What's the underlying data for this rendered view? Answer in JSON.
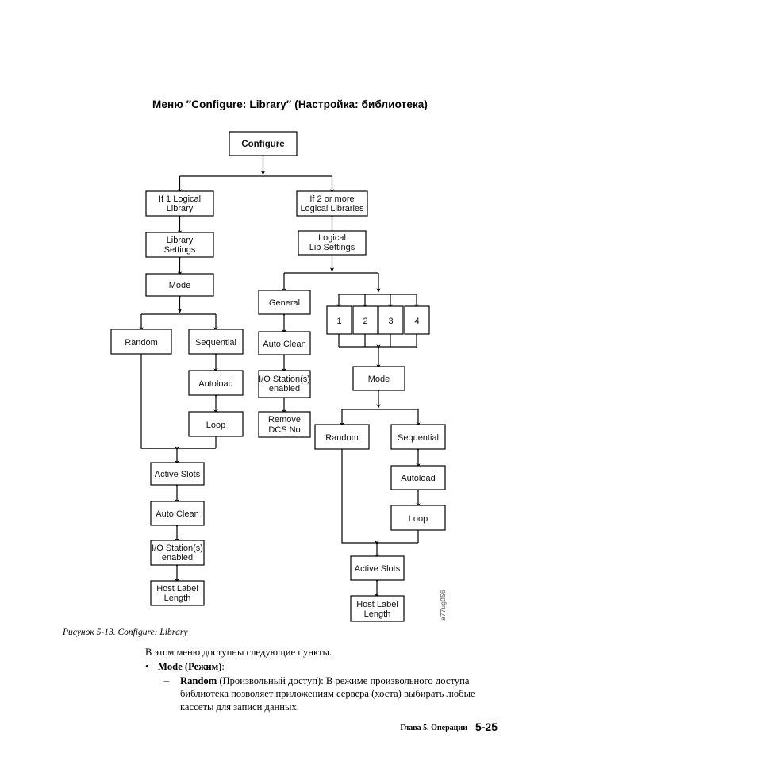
{
  "page": {
    "title": "Меню ″Configure: Library″ (Настройка: библиотека)",
    "figure_caption": "Рисунок 5-13. Configure: Library",
    "figure_id": "a77ug056",
    "intro_paragraph": "В этом меню доступны следующие пункты.",
    "footer_chapter": "Глава 5. Операции",
    "footer_page": "5-25"
  },
  "bullets": {
    "level1_marker": "•",
    "level1_bold": "Mode (Режим)",
    "level1_tail": ":",
    "level2_marker": "–",
    "level2_bold": "Random",
    "level2_text": " (Произвольный доступ): В режиме произвольного доступа библиотека позволяет приложениям сервера (хоста) выбирать любые кассеты для записи данных."
  },
  "diagram": {
    "type": "flowchart",
    "nodes": {
      "configure": "Configure",
      "if_1_logical_library": "If 1 Logical\nLibrary",
      "if_1_logical_library_l1": "If 1 Logical",
      "if_1_logical_library_l2": "Library",
      "if_2_or_more": "If 2 or more\nLogical Libraries",
      "if_2_or_more_l1": "If 2 or more",
      "if_2_or_more_l2": "Logical Libraries",
      "library_settings_l1": "Library",
      "library_settings_l2": "Settings",
      "logical_lib_settings_l1": "Logical",
      "logical_lib_settings_l2": "Lib Settings",
      "mode_left": "Mode",
      "mode_right": "Mode",
      "random_left": "Random",
      "sequential_left": "Sequential",
      "autoload_left": "Autoload",
      "loop_left": "Loop",
      "active_slots_left": "Active Slots",
      "auto_clean_left": "Auto Clean",
      "io_station_left_l1": "I/O Station(s)",
      "io_station_left_l2": "enabled",
      "host_label_left_l1": "Host Label",
      "host_label_left_l2": "Length",
      "general": "General",
      "auto_clean_mid": "Auto Clean",
      "io_station_mid_l1": "I/O Station(s)",
      "io_station_mid_l2": "enabled",
      "remove_dcs_l1": "Remove",
      "remove_dcs_l2": "DCS No",
      "ll_1": "1",
      "ll_2": "2",
      "ll_3": "3",
      "ll_4": "4",
      "random_right": "Random",
      "sequential_right": "Sequential",
      "autoload_right": "Autoload",
      "loop_right": "Loop",
      "active_slots_right": "Active Slots",
      "host_label_right_l1": "Host Label",
      "host_label_right_l2": "Length"
    }
  }
}
